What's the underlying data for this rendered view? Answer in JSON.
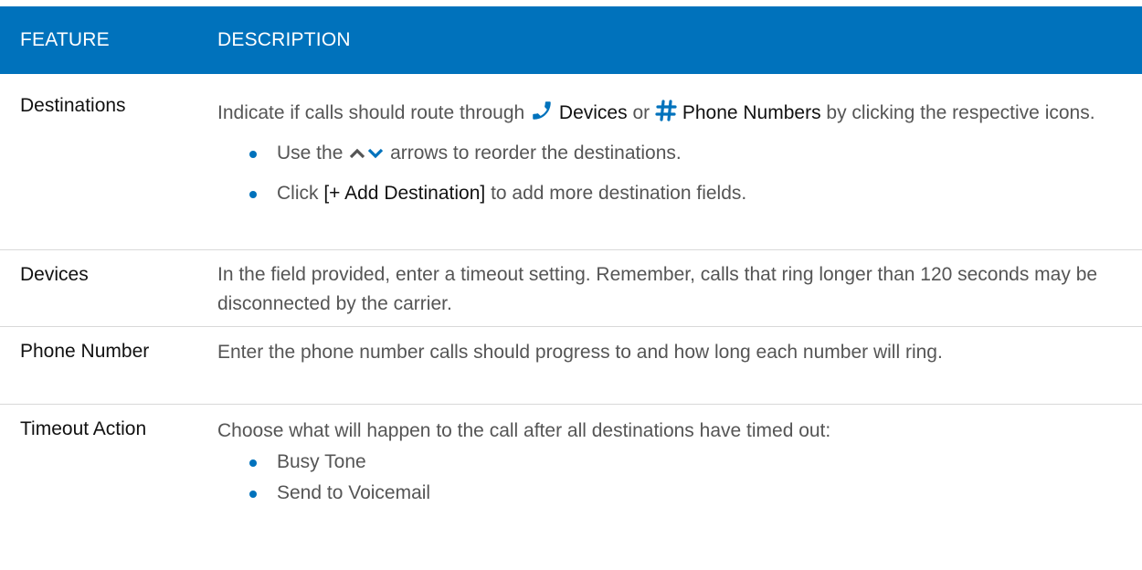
{
  "header": {
    "feature_label": "FEATURE",
    "description_label": "DESCRIPTION"
  },
  "rows": [
    {
      "feature": "Destinations",
      "desc_intro_1": "Indicate if calls should route through",
      "devices_label": "Devices",
      "or_text": "or",
      "phone_numbers_label": "Phone Numbers",
      "desc_intro_2": "by clicking the respective icons.",
      "bullet_1_pre": "Use the",
      "bullet_1_post": "arrows to reorder the destinations.",
      "bullet_2_pre": "Click",
      "bullet_2_button": "[+ Add Destination]",
      "bullet_2_post": "to add more destination fields."
    },
    {
      "feature": "Devices",
      "description": "In the field provided, enter a timeout setting. Remember, calls that ring longer than 120 seconds may be disconnected by the carrier."
    },
    {
      "feature": "Phone Number",
      "description": "Enter the phone number calls should progress to and how long each number will ring."
    },
    {
      "feature": "Timeout Action",
      "description": "Choose what will happen to the call after all destinations have timed out:",
      "options": [
        "Busy Tone",
        "Send to Voicemail"
      ]
    }
  ],
  "icons": {
    "phone": "phone-icon",
    "hash": "hash-icon",
    "up": "chevron-up-icon",
    "down": "chevron-down-icon"
  },
  "colors": {
    "header_bg": "#0072bc",
    "bullet": "#0072bc",
    "icon": "#0072bc"
  }
}
